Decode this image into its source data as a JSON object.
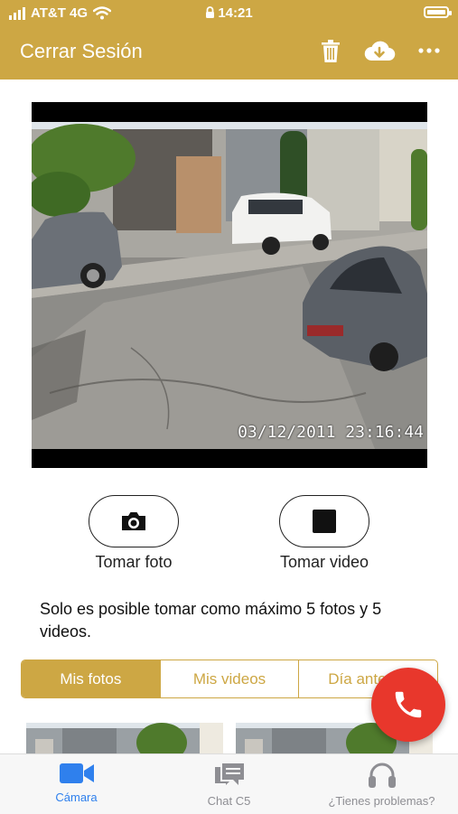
{
  "status_bar": {
    "carrier": "AT&T 4G",
    "time": "14:21",
    "battery_level": 1.0
  },
  "header": {
    "title": "Cerrar Sesión",
    "icons": [
      "trash-icon",
      "cloud-download-icon",
      "more-icon"
    ]
  },
  "camera_feed": {
    "timestamp": "03/12/2011 23:16:44"
  },
  "actions": {
    "photo_label": "Tomar foto",
    "video_label": "Tomar video"
  },
  "notice": "Solo es posible tomar como máximo 5 fotos y 5 videos.",
  "tabs": [
    {
      "label": "Mis fotos",
      "active": true
    },
    {
      "label": "Mis videos",
      "active": false
    },
    {
      "label": "Día anterior",
      "active": false
    }
  ],
  "tab_bar": [
    {
      "label": "Cámara",
      "icon": "video-camera-icon",
      "active": true
    },
    {
      "label": "Chat C5",
      "icon": "chat-icon",
      "active": false
    },
    {
      "label": "¿Tienes problemas?",
      "icon": "headset-icon",
      "active": false
    }
  ],
  "colors": {
    "accent": "#cda744",
    "call_button": "#e8372c",
    "tab_active": "#2f80ed"
  }
}
